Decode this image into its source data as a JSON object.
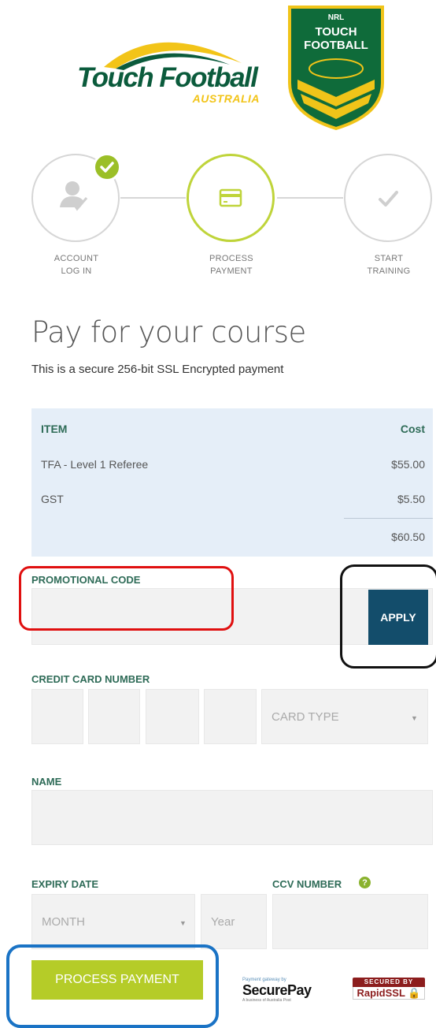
{
  "logos": {
    "tfa_main": "Touch Football",
    "tfa_sub": "AUSTRALIA",
    "nrl_small": "NRL",
    "nrl_line1": "TOUCH",
    "nrl_line2": "FOOTBALL"
  },
  "steps": [
    {
      "label_line1": "ACCOUNT",
      "label_line2": "LOG IN",
      "state": "complete",
      "icon": "user-icon"
    },
    {
      "label_line1": "PROCESS",
      "label_line2": "PAYMENT",
      "state": "active",
      "icon": "credit-card-icon"
    },
    {
      "label_line1": "START",
      "label_line2": "TRAINING",
      "state": "pending",
      "icon": "checkmark-icon"
    }
  ],
  "page": {
    "title": "Pay for your course",
    "subtitle": "This is a secure 256-bit SSL Encrypted payment"
  },
  "order": {
    "col_item": "ITEM",
    "col_cost": "Cost",
    "rows": [
      {
        "item": "TFA - Level 1 Referee",
        "cost": "$55.00"
      },
      {
        "item": "GST",
        "cost": "$5.50"
      }
    ],
    "total": "$60.50"
  },
  "form": {
    "promo_label": "PROMOTIONAL CODE",
    "promo_value": "",
    "apply_label": "APPLY",
    "card_label": "CREDIT CARD NUMBER",
    "card_type_placeholder": "CARD TYPE",
    "name_label": "NAME",
    "name_value": "",
    "expiry_label": "EXPIRY DATE",
    "month_placeholder": "MONTH",
    "year_placeholder": "Year",
    "ccv_label": "CCV NUMBER",
    "pay_button": "PROCESS PAYMENT"
  },
  "partners": {
    "securepay_small": "Payment gateway by",
    "securepay_main": "SecurePay",
    "securepay_tiny": "A business of Australia Post",
    "rapidssl_top": "SECURED BY",
    "rapidssl_main": "RapidSSL"
  },
  "colors": {
    "accent_green": "#b5cc28",
    "label_green": "#2e6b57",
    "apply_blue": "#134d6b",
    "table_bg": "#e5eef8"
  }
}
